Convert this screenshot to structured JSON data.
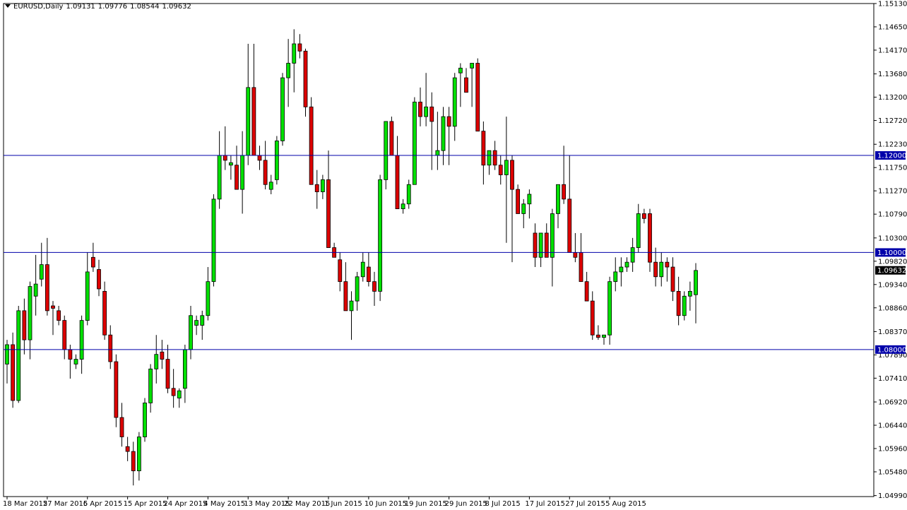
{
  "header": {
    "symbol": "EURUSD,Daily",
    "open": "1.09131",
    "high": "1.09776",
    "low": "1.08544",
    "close": "1.09632"
  },
  "colors": {
    "background": "#ffffff",
    "axis": "#000000",
    "bull": "#00e000",
    "bear": "#dd0000",
    "wick": "#000000",
    "hline": "#0000aa",
    "price_tag": "#000000"
  },
  "chart_data": {
    "type": "candlestick",
    "ylim": [
      1.0497,
      1.1513
    ],
    "y_ticks": [
      "1.15130",
      "1.14650",
      "1.14170",
      "1.13680",
      "1.13200",
      "1.12720",
      "1.12230",
      "1.11750",
      "1.11270",
      "1.10790",
      "1.10300",
      "1.09820",
      "1.09340",
      "1.08860",
      "1.08370",
      "1.07890",
      "1.07410",
      "1.06920",
      "1.06440",
      "1.05960",
      "1.05480",
      "1.04990"
    ],
    "x_labels": [
      "18 Mar 2015",
      "27 Mar 2015",
      "6 Apr 2015",
      "15 Apr 2015",
      "24 Apr 2015",
      "4 May 2015",
      "13 May 2015",
      "22 May 2015",
      "1 Jun 2015",
      "10 Jun 2015",
      "19 Jun 2015",
      "29 Jun 2015",
      "8 Jul 2015",
      "17 Jul 2015",
      "27 Jul 2015",
      "5 Aug 2015"
    ],
    "horizontal_lines": [
      "1.12000",
      "1.10000",
      "1.08000"
    ],
    "current_price": "1.09632",
    "grid": false,
    "candles": [
      [
        1.077,
        1.082,
        1.073,
        1.081
      ],
      [
        1.081,
        1.0835,
        1.068,
        1.0695
      ],
      [
        1.0695,
        1.089,
        1.069,
        1.088
      ],
      [
        1.088,
        1.0905,
        1.079,
        1.082
      ],
      [
        1.082,
        1.094,
        1.078,
        1.093
      ],
      [
        1.091,
        1.0995,
        1.087,
        1.0935
      ],
      [
        1.0945,
        1.102,
        1.093,
        1.0975
      ],
      [
        1.0975,
        1.103,
        1.087,
        1.088
      ],
      [
        1.089,
        1.09,
        1.083,
        1.0885
      ],
      [
        1.088,
        1.089,
        1.085,
        1.086
      ],
      [
        1.086,
        1.087,
        1.078,
        1.08
      ],
      [
        1.08,
        1.081,
        1.074,
        1.078
      ],
      [
        1.077,
        1.079,
        1.076,
        1.078
      ],
      [
        1.078,
        1.087,
        1.075,
        1.086
      ],
      [
        1.086,
        1.1,
        1.085,
        1.096
      ],
      [
        1.099,
        1.102,
        1.096,
        1.097
      ],
      [
        1.0965,
        1.0985,
        1.091,
        1.0925
      ],
      [
        1.092,
        1.094,
        1.082,
        1.083
      ],
      [
        1.083,
        1.085,
        1.076,
        1.0775
      ],
      [
        1.0775,
        1.079,
        1.064,
        1.066
      ],
      [
        1.066,
        1.069,
        1.06,
        1.062
      ],
      [
        1.06,
        1.062,
        1.057,
        1.059
      ],
      [
        1.059,
        1.061,
        1.052,
        1.055
      ],
      [
        1.055,
        1.063,
        1.053,
        1.062
      ],
      [
        1.062,
        1.07,
        1.061,
        1.069
      ],
      [
        1.069,
        1.077,
        1.067,
        1.076
      ],
      [
        1.076,
        1.083,
        1.073,
        1.079
      ],
      [
        1.0795,
        1.082,
        1.076,
        1.078
      ],
      [
        1.078,
        1.081,
        1.071,
        1.072
      ],
      [
        1.072,
        1.076,
        1.068,
        1.0705
      ],
      [
        1.07,
        1.072,
        1.068,
        1.0715
      ],
      [
        1.072,
        1.081,
        1.069,
        1.08
      ],
      [
        1.08,
        1.089,
        1.078,
        1.087
      ],
      [
        1.085,
        1.087,
        1.083,
        1.086
      ],
      [
        1.085,
        1.088,
        1.082,
        1.087
      ],
      [
        1.087,
        1.097,
        1.086,
        1.094
      ],
      [
        1.094,
        1.112,
        1.093,
        1.111
      ],
      [
        1.111,
        1.125,
        1.109,
        1.12
      ],
      [
        1.12,
        1.126,
        1.117,
        1.119
      ],
      [
        1.118,
        1.12,
        1.115,
        1.1185
      ],
      [
        1.118,
        1.122,
        1.113,
        1.113
      ],
      [
        1.113,
        1.125,
        1.108,
        1.12
      ],
      [
        1.12,
        1.143,
        1.118,
        1.134
      ],
      [
        1.134,
        1.143,
        1.12,
        1.12
      ],
      [
        1.12,
        1.122,
        1.117,
        1.119
      ],
      [
        1.119,
        1.123,
        1.113,
        1.114
      ],
      [
        1.113,
        1.116,
        1.112,
        1.1145
      ],
      [
        1.115,
        1.124,
        1.114,
        1.123
      ],
      [
        1.123,
        1.137,
        1.122,
        1.136
      ],
      [
        1.136,
        1.144,
        1.13,
        1.139
      ],
      [
        1.139,
        1.146,
        1.133,
        1.143
      ],
      [
        1.143,
        1.145,
        1.14,
        1.1415
      ],
      [
        1.1415,
        1.142,
        1.128,
        1.13
      ],
      [
        1.13,
        1.132,
        1.114,
        1.114
      ],
      [
        1.114,
        1.117,
        1.109,
        1.1125
      ],
      [
        1.1125,
        1.116,
        1.111,
        1.115
      ],
      [
        1.115,
        1.121,
        1.107,
        1.101
      ],
      [
        1.101,
        1.102,
        1.099,
        1.099
      ],
      [
        1.0985,
        1.1,
        1.092,
        1.094
      ],
      [
        1.094,
        1.098,
        1.088,
        1.088
      ],
      [
        1.088,
        1.092,
        1.082,
        1.09
      ],
      [
        1.09,
        1.096,
        1.088,
        1.095
      ],
      [
        1.095,
        1.1,
        1.094,
        1.098
      ],
      [
        1.097,
        1.1,
        1.093,
        1.094
      ],
      [
        1.094,
        1.096,
        1.089,
        1.092
      ],
      [
        1.092,
        1.116,
        1.09,
        1.115
      ],
      [
        1.115,
        1.127,
        1.113,
        1.127
      ],
      [
        1.127,
        1.128,
        1.12,
        1.12
      ],
      [
        1.12,
        1.124,
        1.114,
        1.109
      ],
      [
        1.109,
        1.111,
        1.108,
        1.11
      ],
      [
        1.11,
        1.115,
        1.109,
        1.114
      ],
      [
        1.114,
        1.132,
        1.114,
        1.131
      ],
      [
        1.131,
        1.134,
        1.126,
        1.128
      ],
      [
        1.128,
        1.137,
        1.126,
        1.13
      ],
      [
        1.13,
        1.133,
        1.117,
        1.127
      ],
      [
        1.12,
        1.129,
        1.117,
        1.121
      ],
      [
        1.121,
        1.13,
        1.118,
        1.128
      ],
      [
        1.128,
        1.13,
        1.118,
        1.126
      ],
      [
        1.126,
        1.137,
        1.123,
        1.136
      ],
      [
        1.137,
        1.139,
        1.13,
        1.138
      ],
      [
        1.136,
        1.138,
        1.133,
        1.133
      ],
      [
        1.138,
        1.139,
        1.13,
        1.139
      ],
      [
        1.139,
        1.14,
        1.125,
        1.125
      ],
      [
        1.125,
        1.127,
        1.114,
        1.118
      ],
      [
        1.118,
        1.121,
        1.116,
        1.121
      ],
      [
        1.121,
        1.123,
        1.117,
        1.118
      ],
      [
        1.118,
        1.12,
        1.114,
        1.116
      ],
      [
        1.116,
        1.128,
        1.102,
        1.119
      ],
      [
        1.119,
        1.12,
        1.098,
        1.113
      ],
      [
        1.113,
        1.114,
        1.108,
        1.108
      ],
      [
        1.108,
        1.111,
        1.105,
        1.11
      ],
      [
        1.11,
        1.113,
        1.107,
        1.112
      ],
      [
        1.104,
        1.106,
        1.097,
        1.099
      ],
      [
        1.099,
        1.104,
        1.097,
        1.104
      ],
      [
        1.104,
        1.106,
        1.1,
        1.099
      ],
      [
        1.099,
        1.109,
        1.093,
        1.108
      ],
      [
        1.108,
        1.112,
        1.105,
        1.114
      ],
      [
        1.114,
        1.122,
        1.11,
        1.111
      ],
      [
        1.111,
        1.12,
        1.106,
        1.1
      ],
      [
        1.1,
        1.104,
        1.098,
        1.099
      ],
      [
        1.1,
        1.104,
        1.097,
        1.094
      ],
      [
        1.094,
        1.096,
        1.09,
        1.09
      ],
      [
        1.09,
        1.092,
        1.082,
        1.083
      ],
      [
        1.083,
        1.085,
        1.082,
        1.0825
      ],
      [
        1.0825,
        1.083,
        1.081,
        1.083
      ],
      [
        1.083,
        1.095,
        1.081,
        1.094
      ],
      [
        1.094,
        1.099,
        1.092,
        1.096
      ],
      [
        1.096,
        1.099,
        1.093,
        1.097
      ],
      [
        1.097,
        1.099,
        1.096,
        1.098
      ],
      [
        1.098,
        1.103,
        1.096,
        1.101
      ],
      [
        1.101,
        1.11,
        1.1,
        1.108
      ],
      [
        1.108,
        1.109,
        1.106,
        1.107
      ],
      [
        1.108,
        1.109,
        1.096,
        1.098
      ],
      [
        1.098,
        1.101,
        1.093,
        1.095
      ],
      [
        1.095,
        1.1,
        1.093,
        1.098
      ],
      [
        1.098,
        1.099,
        1.094,
        1.097
      ],
      [
        1.097,
        1.099,
        1.09,
        1.092
      ],
      [
        1.092,
        1.095,
        1.085,
        1.087
      ],
      [
        1.087,
        1.092,
        1.086,
        1.091
      ],
      [
        1.091,
        1.094,
        1.088,
        1.092
      ],
      [
        1.0913,
        1.0978,
        1.0854,
        1.0963
      ]
    ]
  }
}
